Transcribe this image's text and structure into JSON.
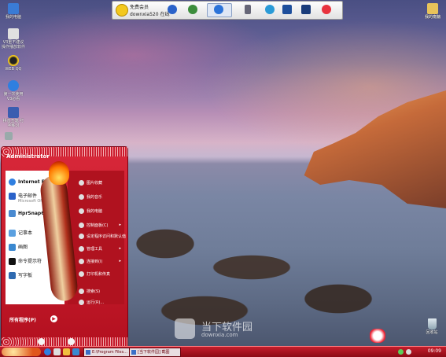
{
  "desktop": {
    "left_icons": [
      {
        "label": "我的电脑",
        "icon": "computer-icon"
      },
      {
        "label": "V3重不建议 操作播放软件",
        "icon": "v3-icon"
      },
      {
        "label": "WEB QQ",
        "icon": "qq-penguin-icon"
      },
      {
        "label": "第一次使用 V3必看",
        "icon": "ie-icon"
      },
      {
        "label": "拼音五笔 打字练习",
        "icon": "typing-icon"
      }
    ],
    "right_icons": [
      {
        "label": "我的电脑",
        "icon": "computer-icon"
      },
      {
        "label": "我的文档",
        "icon": "documents-icon"
      }
    ],
    "recycle_bin": {
      "label": "回收站",
      "icon": "recycle-bin-icon"
    }
  },
  "top_toolbar": {
    "member_label": "免费会员",
    "user_label": "downxia520 在线",
    "icons": [
      "vip-badge-icon",
      "help-icon",
      "globe-icon",
      "refresh-icon",
      "usb-icon",
      "earth-icon",
      "network-icon",
      "monitor-icon",
      "power-icon"
    ]
  },
  "start_menu": {
    "user": "Administrator",
    "left_items": [
      {
        "label": "Internet Explorer",
        "sub": "",
        "icon": "ie-icon"
      },
      {
        "label": "电子邮件",
        "sub": "Microsoft Office ...",
        "icon": "email-icon"
      },
      {
        "label": "HprSnap6",
        "sub": "",
        "icon": "hypersnap-icon"
      },
      {
        "label": "记事本",
        "sub": "",
        "icon": "notepad-icon"
      },
      {
        "label": "画图",
        "sub": "",
        "icon": "paint-icon"
      },
      {
        "label": "命令提示符",
        "sub": "",
        "icon": "cmd-icon"
      },
      {
        "label": "写字板",
        "sub": "",
        "icon": "wordpad-icon"
      }
    ],
    "right_items": [
      {
        "label": "图片收藏",
        "arrow": false
      },
      {
        "label": "我的音乐",
        "arrow": false
      },
      {
        "label": "我的电脑",
        "arrow": false
      },
      {
        "label": "控制面板(C)",
        "arrow": true
      },
      {
        "label": "设定程序访问和默认值",
        "arrow": false
      },
      {
        "label": "管理工具",
        "arrow": true
      },
      {
        "label": "连接到(I)",
        "arrow": true
      },
      {
        "label": "打印机和传真",
        "arrow": false
      },
      {
        "label": "搜索(S)",
        "arrow": false
      },
      {
        "label": "运行(R)...",
        "arrow": false
      }
    ],
    "all_programs": "所有程序(P)",
    "all_programs_arrow": "▶"
  },
  "taskbar": {
    "tasks": [
      {
        "label": "E:\\Program Files..."
      },
      {
        "label": "[当下软件园] 截图"
      }
    ],
    "clock": "09:09"
  },
  "watermark": {
    "title": "当下软件园",
    "url": "downxia.com"
  },
  "colors": {
    "menu_red": "#c8182a",
    "taskbar_red": "#a8101d"
  }
}
